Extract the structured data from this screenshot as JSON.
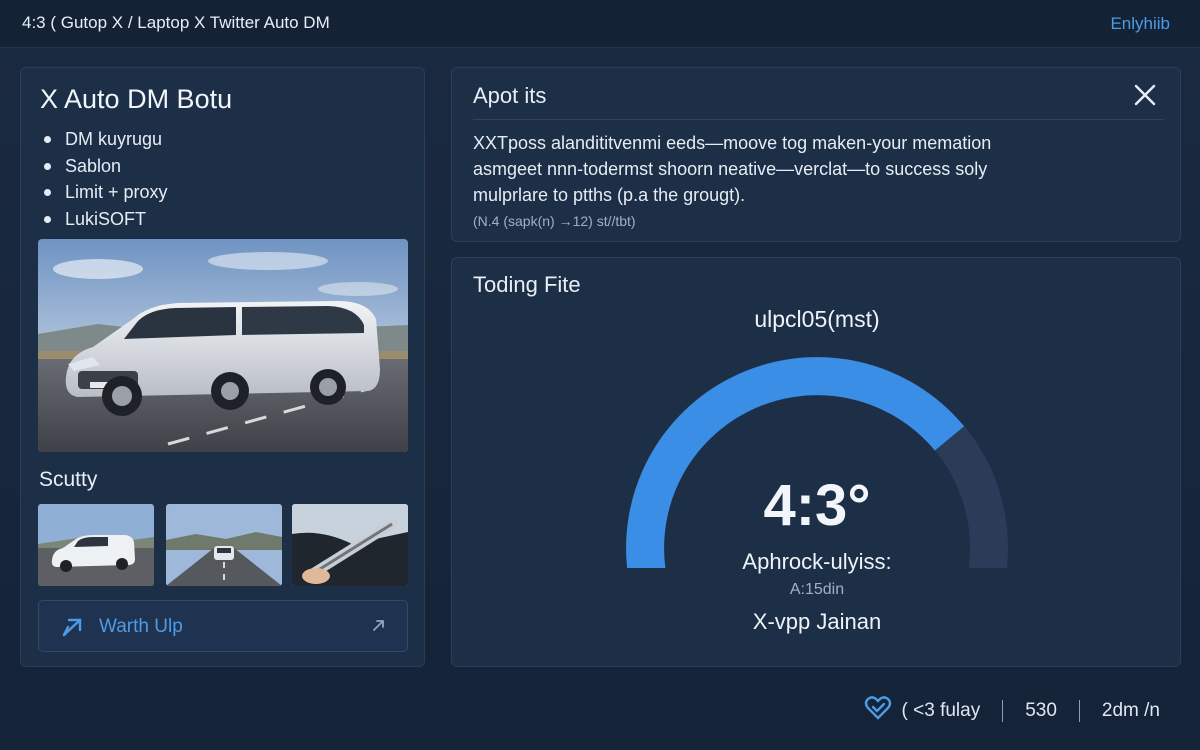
{
  "header": {
    "title": "4:3 ( Gutop  X / Laptop X Twitter Auto DM",
    "right_link": "Enlyhiib"
  },
  "left_panel": {
    "title": "X Auto DM Botu",
    "features": [
      "DM kuyrugu",
      "Sablon",
      "Limit + proxy",
      "LukiSOFT"
    ],
    "gallery_label": "Scutty",
    "action_button": {
      "label": "Warth Ulp",
      "icon": "external-arrow-icon",
      "chevron": "›"
    }
  },
  "about_panel": {
    "title": "Apot its",
    "close_icon": "close-icon",
    "text_lines": [
      "XXTposs alandititvenmi eeds—moove tog maken-your memation",
      "asmgeet nnn-todermst shoorn neative—verclat—to success soly",
      "mulprlare to ptths (p.a the grougt)."
    ],
    "meta": "(N.4 (sapk(n) →12) st//tbt)"
  },
  "gauge_panel": {
    "title": "Toding Fite",
    "header": "ulpcl05(mst)",
    "value": "4:3°",
    "label": "Aphrock-ulyiss:",
    "sub": "A:15din",
    "foot": "X-vpp Jainan",
    "level": 0.74,
    "accent_color": "#3a8ee6",
    "track_color": "#2a3c57"
  },
  "status": {
    "icon": "heart-check-icon",
    "items": [
      "( <3 fulay",
      "530",
      "2dm /n"
    ]
  },
  "colors": {
    "background": "#16263b",
    "panel": "#1d2f47",
    "accent": "#4d9be6"
  }
}
